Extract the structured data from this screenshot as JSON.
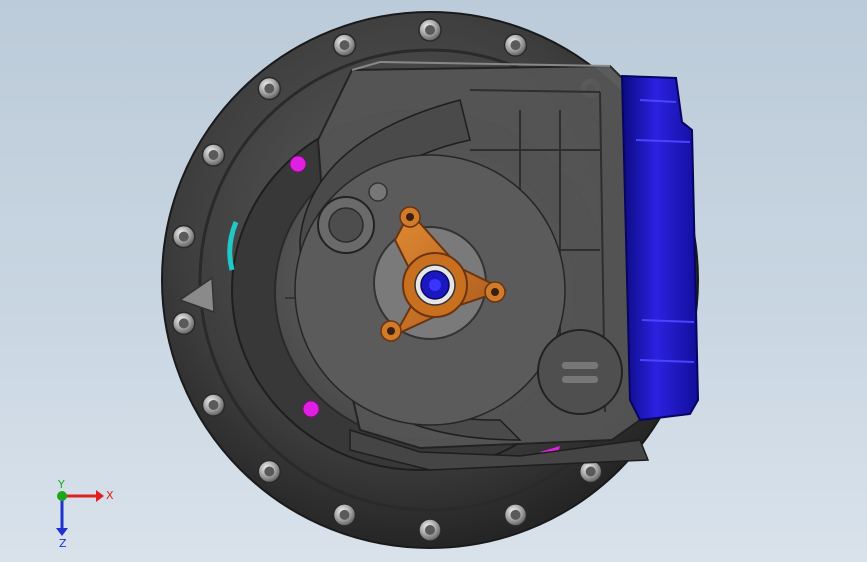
{
  "triad": {
    "x_label": "X",
    "y_label": "Y",
    "z_label": "Z",
    "x_color": "#e02020",
    "y_color": "#1aa81a",
    "z_color": "#2030d0"
  },
  "colors": {
    "housing": "#3c3c3c",
    "housing_light": "#5a5a5a",
    "hub": "#c8701e",
    "cover": "#1a14c8",
    "marker": "#e020e0",
    "seal": "#20c8c8",
    "background": "#c4d2df"
  }
}
